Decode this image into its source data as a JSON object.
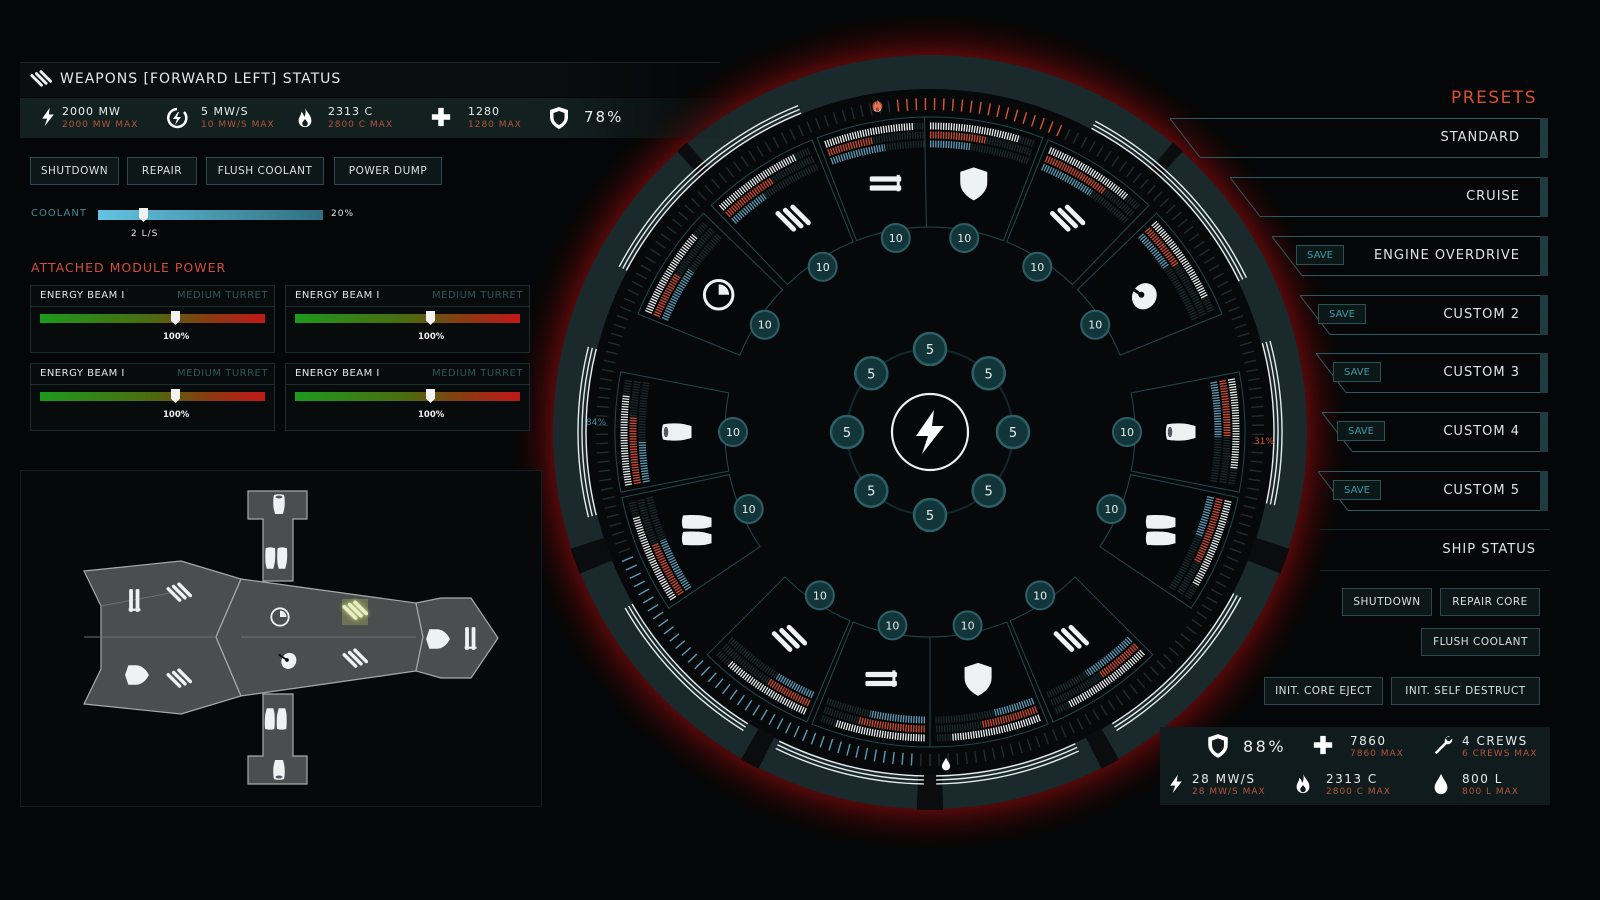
{
  "colors": {
    "accent_red": "#d0503a",
    "teal": "#2c6068",
    "coolant_blue": "#5d9ab8",
    "heat_orange": "#d8572f"
  },
  "weapons_panel": {
    "title": "WEAPONS [FORWARD LEFT] STATUS",
    "title_icon": "missile-triple-icon",
    "stats": [
      {
        "icon": "bolt-icon",
        "value": "2000 MW",
        "max": "2000 MW MAX"
      },
      {
        "icon": "power-cycle-icon",
        "value": "5 MW/S",
        "max": "10 MW/S MAX"
      },
      {
        "icon": "flame-icon",
        "value": "2313 C",
        "max": "2800 C MAX"
      },
      {
        "icon": "plus-icon",
        "value": "1280",
        "max": "1280 MAX"
      }
    ],
    "shield": {
      "icon": "shield-icon",
      "value": "78%"
    },
    "buttons": [
      "SHUTDOWN",
      "REPAIR",
      "FLUSH COOLANT",
      "POWER DUMP"
    ],
    "coolant": {
      "label": "COOLANT",
      "percent": 20,
      "percent_label": "20%",
      "rate": "2 L/S"
    }
  },
  "module_power": {
    "title": "ATTACHED MODULE POWER",
    "modules": [
      {
        "name": "ENERGY BEAM I",
        "type": "MEDIUM TURRET",
        "power_label": "100%",
        "slider_level": 0.6
      },
      {
        "name": "ENERGY BEAM I",
        "type": "MEDIUM TURRET",
        "power_label": "100%",
        "slider_level": 0.6
      },
      {
        "name": "ENERGY BEAM I",
        "type": "MEDIUM TURRET",
        "power_label": "100%",
        "slider_level": 0.6
      },
      {
        "name": "ENERGY BEAM I",
        "type": "MEDIUM TURRET",
        "power_label": "100%",
        "slider_level": 0.6
      }
    ]
  },
  "reactor": {
    "core_icon": "bolt-icon",
    "node_values": [
      "5",
      "5",
      "5",
      "5",
      "5",
      "5",
      "5",
      "5"
    ],
    "left_gauge": "84%",
    "right_gauge": "31%",
    "top_gauge_icon": "flame-icon",
    "bottom_gauge_icon": "drop-icon",
    "modules": [
      {
        "icon": "rail-gun",
        "value": "10",
        "angle": -10
      },
      {
        "icon": "shield",
        "value": "10",
        "angle": 10
      },
      {
        "icon": "missile-triple",
        "value": "10",
        "angle": 33
      },
      {
        "icon": "radar-dish",
        "value": "10",
        "angle": 57
      },
      {
        "icon": "thruster",
        "value": "10",
        "angle": 90
      },
      {
        "icon": "thruster-double",
        "value": "10",
        "angle": 113
      },
      {
        "icon": "missile-triple",
        "value": "10",
        "angle": 146
      },
      {
        "icon": "shield",
        "value": "10",
        "angle": 169
      },
      {
        "icon": "rail-gun",
        "value": "10",
        "angle": -169
      },
      {
        "icon": "missile-triple",
        "value": "10",
        "angle": -146
      },
      {
        "icon": "thruster-double",
        "value": "10",
        "angle": -113
      },
      {
        "icon": "thruster",
        "value": "10",
        "angle": -90
      },
      {
        "icon": "sensor-pie",
        "value": "10",
        "angle": -57
      },
      {
        "icon": "missile-triple",
        "value": "10",
        "angle": -33
      }
    ]
  },
  "presets": {
    "title": "PRESETS",
    "save_label": "SAVE",
    "items": [
      {
        "label": "STANDARD",
        "has_save": false
      },
      {
        "label": "CRUISE",
        "has_save": false
      },
      {
        "label": "ENGINE OVERDRIVE",
        "has_save": true
      },
      {
        "label": "CUSTOM 2",
        "has_save": true
      },
      {
        "label": "CUSTOM 3",
        "has_save": true
      },
      {
        "label": "CUSTOM 4",
        "has_save": true
      },
      {
        "label": "CUSTOM 5",
        "has_save": true
      }
    ]
  },
  "ship_status": {
    "title": "SHIP STATUS",
    "buttons": [
      "SHUTDOWN",
      "REPAIR CORE",
      "FLUSH COOLANT",
      "INIT. CORE EJECT",
      "INIT. SELF DESTRUCT"
    ],
    "shield": {
      "icon": "shield-icon",
      "value": "88%"
    },
    "stats": [
      {
        "icon": "plus-icon",
        "value": "7860",
        "max": "7860 MAX"
      },
      {
        "icon": "wrench-icon",
        "value": "4 CREWS",
        "max": "6 CREWS MAX"
      },
      {
        "icon": "bolt-icon",
        "value": "28 MW/S",
        "max": "28 MW/S MAX"
      },
      {
        "icon": "flame-icon",
        "value": "2313 C",
        "max": "2800 C MAX"
      },
      {
        "icon": "drop-icon",
        "value": "800 L",
        "max": "800 L MAX"
      }
    ]
  }
}
